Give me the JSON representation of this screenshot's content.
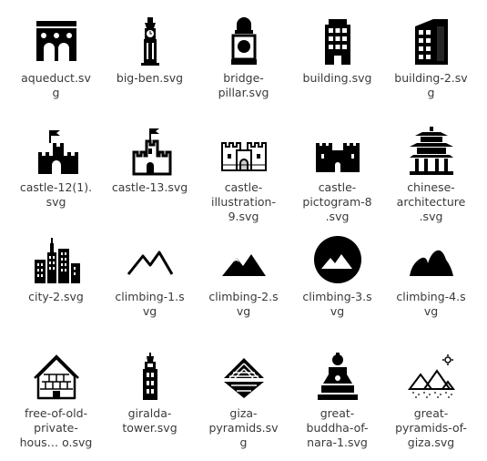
{
  "files": [
    {
      "icon": "aqueduct-icon",
      "label": "aqueduct.sv\ng"
    },
    {
      "icon": "big-ben-icon",
      "label": "big-ben.svg"
    },
    {
      "icon": "bridge-pillar-icon",
      "label": "bridge-\npillar.svg"
    },
    {
      "icon": "building-icon",
      "label": "building.svg"
    },
    {
      "icon": "building-2-icon",
      "label": "building-2.sv\ng"
    },
    {
      "icon": "castle-12-icon",
      "label": "castle-12(1).\nsvg"
    },
    {
      "icon": "castle-13-icon",
      "label": "castle-13.svg"
    },
    {
      "icon": "castle-illustration-icon",
      "label": "castle-\nillustration-\n9.svg"
    },
    {
      "icon": "castle-pictogram-icon",
      "label": "castle-\npictogram-8\n.svg"
    },
    {
      "icon": "chinese-architecture-icon",
      "label": "chinese-\narchitecture\n.svg"
    },
    {
      "icon": "city-icon",
      "label": "city-2.svg"
    },
    {
      "icon": "climbing-1-icon",
      "label": "climbing-1.s\nvg"
    },
    {
      "icon": "climbing-2-icon",
      "label": "climbing-2.s\nvg"
    },
    {
      "icon": "climbing-3-icon",
      "label": "climbing-3.s\nvg"
    },
    {
      "icon": "climbing-4-icon",
      "label": "climbing-4.s\nvg"
    },
    {
      "icon": "old-house-icon",
      "label": "free-of-old-\nprivate-\nhous… o.svg"
    },
    {
      "icon": "giralda-tower-icon",
      "label": "giralda-\ntower.svg"
    },
    {
      "icon": "giza-pyramids-icon",
      "label": "giza-\npyramids.sv\ng"
    },
    {
      "icon": "great-buddha-icon",
      "label": "great-\nbuddha-of-\nnara-1.svg"
    },
    {
      "icon": "great-pyramids-icon",
      "label": "great-\npyramids-of-\ngiza.svg"
    }
  ]
}
